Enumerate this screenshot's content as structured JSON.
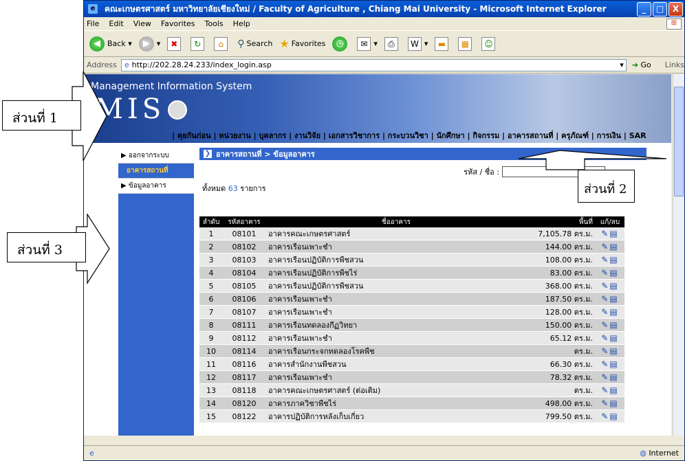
{
  "annotations": {
    "part1": "ส่วนที่ 1",
    "part2": "ส่วนที่ 2",
    "part3": "ส่วนที่ 3"
  },
  "window": {
    "title": "คณะเกษตรศาสตร์ มหาวิทยาลัยเชียงใหม่ / Faculty of Agriculture , Chiang Mai University   - Microsoft Internet Explorer",
    "minimize": "_",
    "maximize": "□",
    "close": "X"
  },
  "menu": [
    "File",
    "Edit",
    "View",
    "Favorites",
    "Tools",
    "Help"
  ],
  "toolbar": {
    "back": "Back",
    "search": "Search",
    "favorites": "Favorites"
  },
  "address": {
    "label": "Address",
    "url": "http://202.28.24.233/index_login.asp",
    "go": "Go",
    "links": "Links"
  },
  "banner": {
    "subtitle": "Management Information System",
    "title": "MIS"
  },
  "topnav": "| คุยกันก่อน | หน่วยงาน | บุคลากร | งานวิจัย | เอกสารวิชาการ | กระบวนวิชา | นักศึกษา | กิจกรรม | อาคารสถานที่ | ครุภัณฑ์ | การเงิน | SAR",
  "sidebar": {
    "logout": "▶ ออกจากระบบ",
    "active": "อาคารสถานที่",
    "buildings": "▶ ข้อมูลอาคาร"
  },
  "main": {
    "breadcrumb": "อาคารสถานที่ > ข้อมูลอาคาร",
    "search_label": "รหัส / ชื่อ :",
    "search_value": "",
    "total_prefix": "ทั้งหมด",
    "total_count": "63",
    "total_suffix": "รายการ"
  },
  "table": {
    "headers": [
      "ลำดับ",
      "รหัสอาคาร",
      "ชื่ออาคาร",
      "พื้นที่",
      "แก้/ลบ"
    ],
    "rows": [
      {
        "no": "1",
        "code": "08101",
        "name": "อาคารคณะเกษตรศาสตร์",
        "area": "7,105.78 ตร.ม."
      },
      {
        "no": "2",
        "code": "08102",
        "name": "อาคารเรือนเพาะชำ",
        "area": "144.00 ตร.ม."
      },
      {
        "no": "3",
        "code": "08103",
        "name": "อาคารเรือนปฏิบัติการพืชสวน",
        "area": "108.00 ตร.ม."
      },
      {
        "no": "4",
        "code": "08104",
        "name": "อาคารเรือนปฏิบัติการพืชไร่",
        "area": "83.00 ตร.ม."
      },
      {
        "no": "5",
        "code": "08105",
        "name": "อาคารเรือนปฏิบัติการพืชสวน",
        "area": "368.00 ตร.ม."
      },
      {
        "no": "6",
        "code": "08106",
        "name": "อาคารเรือนเพาะชำ",
        "area": "187.50 ตร.ม."
      },
      {
        "no": "7",
        "code": "08107",
        "name": "อาคารเรือนเพาะชำ",
        "area": "128.00 ตร.ม."
      },
      {
        "no": "8",
        "code": "08111",
        "name": "อาคารเรือนทดลองกีฏวิทยา",
        "area": "150.00 ตร.ม."
      },
      {
        "no": "9",
        "code": "08112",
        "name": "อาคารเรือนเพาะชำ",
        "area": "65.12 ตร.ม."
      },
      {
        "no": "10",
        "code": "08114",
        "name": "อาคารเรือนกระจกทดลองโรคพืช",
        "area": "ตร.ม."
      },
      {
        "no": "11",
        "code": "08116",
        "name": "อาคารสำนักงานพืชสวน",
        "area": "66.30 ตร.ม."
      },
      {
        "no": "12",
        "code": "08117",
        "name": "อาคารเรือนเพาะชำ",
        "area": "78.32 ตร.ม."
      },
      {
        "no": "13",
        "code": "08118",
        "name": "อาคารคณะเกษตรศาสตร์ (ต่อเติม)",
        "area": "ตร.ม."
      },
      {
        "no": "14",
        "code": "08120",
        "name": "อาคารภาควิชาพืชไร่",
        "area": "498.00 ตร.ม."
      },
      {
        "no": "15",
        "code": "08122",
        "name": "อาคารปฏิบัติการหลังเก็บเกี่ยว",
        "area": "799.50 ตร.ม."
      }
    ],
    "edit_icon": "✎",
    "delete_icon": "▤"
  },
  "status": {
    "zone": "Internet"
  }
}
